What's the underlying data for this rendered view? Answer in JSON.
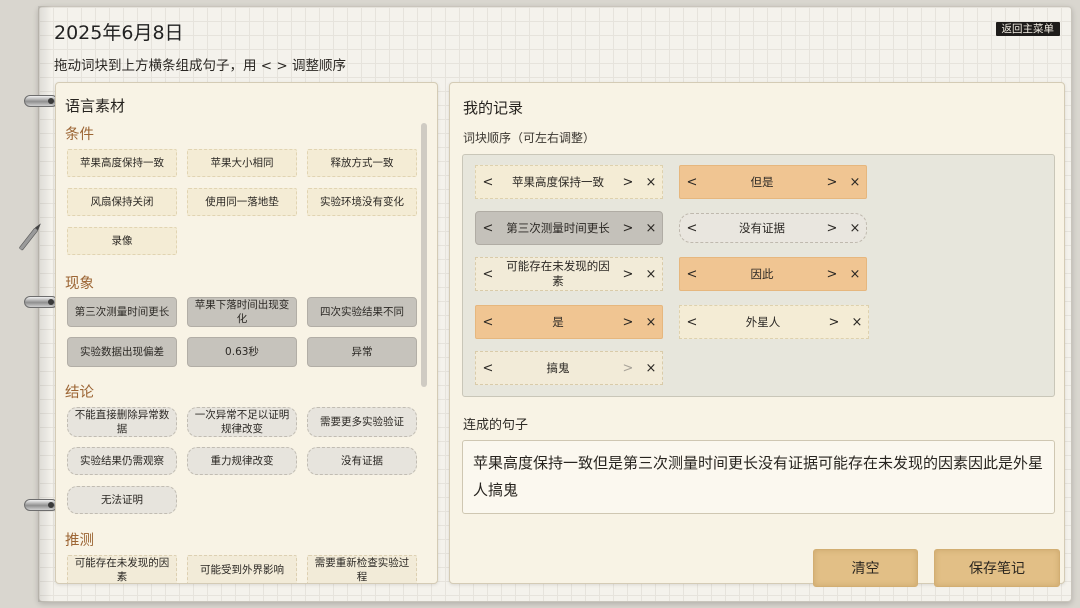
{
  "header": {
    "date": "2025年6月8日",
    "instruction": "拖动词块到上方横条组成句子，用 < > 调整顺序",
    "back_label": "返回主菜单"
  },
  "materials": {
    "title": "语言素材",
    "categories": [
      {
        "name": "条件",
        "items": [
          "苹果高度保持一致",
          "苹果大小相同",
          "释放方式一致",
          "风扇保持关闭",
          "使用同一落地垫",
          "实验环境没有变化",
          "录像"
        ]
      },
      {
        "name": "现象",
        "items": [
          "第三次测量时间更长",
          "苹果下落时间出现变化",
          "四次实验结果不同",
          "实验数据出现偏差",
          "0.63秒",
          "异常"
        ]
      },
      {
        "name": "结论",
        "items": [
          "不能直接删除异常数据",
          "一次异常不足以证明规律改变",
          "需要更多实验验证",
          "实验结果仍需观察",
          "重力规律改变",
          "没有证据",
          "无法证明"
        ]
      },
      {
        "name": "推测",
        "items": [
          "可能存在未发现的因素",
          "可能受到外界影响",
          "需要重新检查实验过程"
        ]
      }
    ],
    "scroll_position": 0.58
  },
  "record": {
    "title": "我的记录",
    "order_label": "词块顺序（可左右调整）",
    "chips": [
      "苹果高度保持一致",
      "但是",
      "第三次测量时间更长",
      "没有证据",
      "可能存在未发现的因素",
      "因此",
      "是",
      "外星人",
      "搞鬼"
    ],
    "result_label": "连成的句子",
    "sentence": "苹果高度保持一致但是第三次测量时间更长没有证据可能存在未发现的因素因此是外星人搞鬼"
  },
  "glyphs": {
    "left": "<",
    "right": ">",
    "remove": "×"
  },
  "actions": {
    "clear_label": "清空",
    "save_label": "保存笔记"
  },
  "colors": {
    "accent_orange": "#f0c592",
    "category_title": "#9c6534",
    "button": "#e2bf86"
  }
}
